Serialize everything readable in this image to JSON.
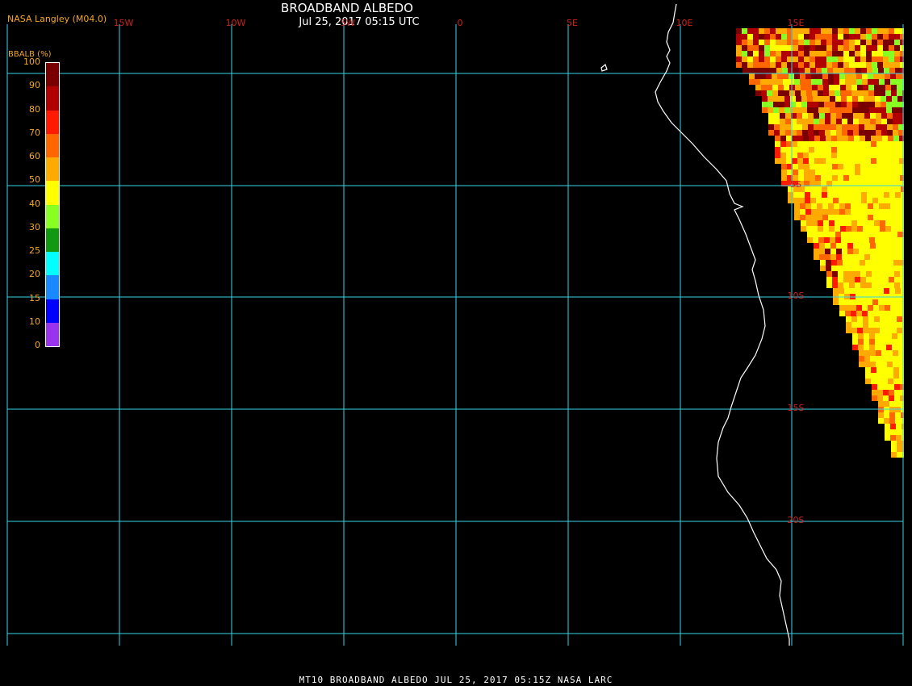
{
  "header": {
    "title": "BROADBAND ALBEDO",
    "subtitle": "Jul 25, 2017 05:15 UTC",
    "source": "NASA Langley (M04.0)"
  },
  "colorbar": {
    "label": "BBALB (%)",
    "ticks": [
      "100",
      "90",
      "80",
      "70",
      "60",
      "50",
      "40",
      "30",
      "25",
      "20",
      "15",
      "10",
      "0"
    ],
    "colors": [
      "#7a0000",
      "#b00000",
      "#ff1a00",
      "#ff6600",
      "#ffaa00",
      "#ffff00",
      "#88ff22",
      "#119911",
      "#00ffff",
      "#1a88ff",
      "#0000ff",
      "#9933ee"
    ]
  },
  "map": {
    "lon_labels": [
      "15W",
      "10W",
      "5W",
      "0",
      "5E",
      "10E",
      "15E"
    ],
    "lat_labels": [
      "5S",
      "10S",
      "15S",
      "20S"
    ],
    "grid_color": "#33d6e6",
    "label_color": "#cc2222",
    "coast_color": "#ffffff"
  },
  "footer": {
    "text": "MT10  BROADBAND ALBEDO   JUL 25, 2017 05:15Z   NASA LARC"
  }
}
